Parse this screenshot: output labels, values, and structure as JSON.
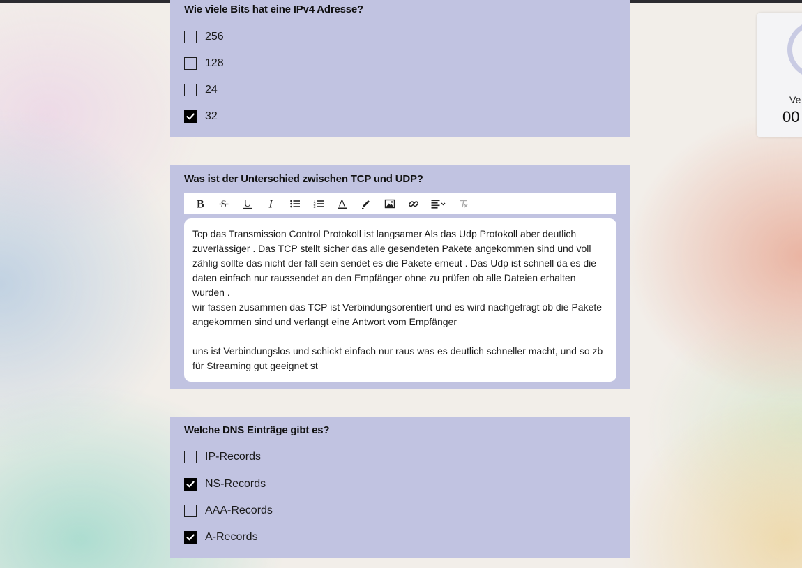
{
  "questions": [
    {
      "title": "Wie viele Bits hat eine IPv4 Adresse?",
      "options": [
        {
          "label": "256",
          "checked": false
        },
        {
          "label": "128",
          "checked": false
        },
        {
          "label": "24",
          "checked": false
        },
        {
          "label": "32",
          "checked": true
        }
      ]
    },
    {
      "title": "Was ist der Unterschied zwischen TCP und UDP?",
      "toolbar": [
        "bold-icon",
        "strikethrough-icon",
        "underline-icon",
        "italic-icon",
        "bullet-list-icon",
        "numbered-list-icon",
        "text-color-icon",
        "highlight-pen-icon",
        "image-icon",
        "link-icon",
        "align-dropdown-icon",
        "clear-format-icon"
      ],
      "answer_paragraphs": [
        "Tcp das Transmission Control Protokoll ist langsamer  Als das Udp Protokoll aber deutlich zuverlässiger . Das TCP stellt sicher das alle gesendeten Pakete angekommen sind und voll zählig sollte das nicht der fall sein sendet es die Pakete erneut . Das Udp ist schnell da es die daten einfach nur raussendet an den Empfänger ohne zu prüfen ob alle Dateien erhalten wurden .",
        "wir fassen zusammen das TCP ist Verbindungsorentiert und es wird nachgefragt ob die Pakete angekommen sind und verlangt eine Antwort vom Empfänger",
        "",
        "uns ist Verbindungslos und schickt einfach nur raus was es deutlich schneller macht, und so zb für Streaming gut geeignet st"
      ]
    },
    {
      "title": "Welche DNS Einträge gibt es?",
      "options": [
        {
          "label": "IP-Records",
          "checked": false
        },
        {
          "label": "NS-Records",
          "checked": true
        },
        {
          "label": "AAA-Records",
          "checked": false
        },
        {
          "label": "A-Records",
          "checked": true
        }
      ]
    }
  ],
  "timer": {
    "label": "Ve",
    "value": "00"
  },
  "colors": {
    "card": "#c1c3e1",
    "check": "#000000"
  }
}
